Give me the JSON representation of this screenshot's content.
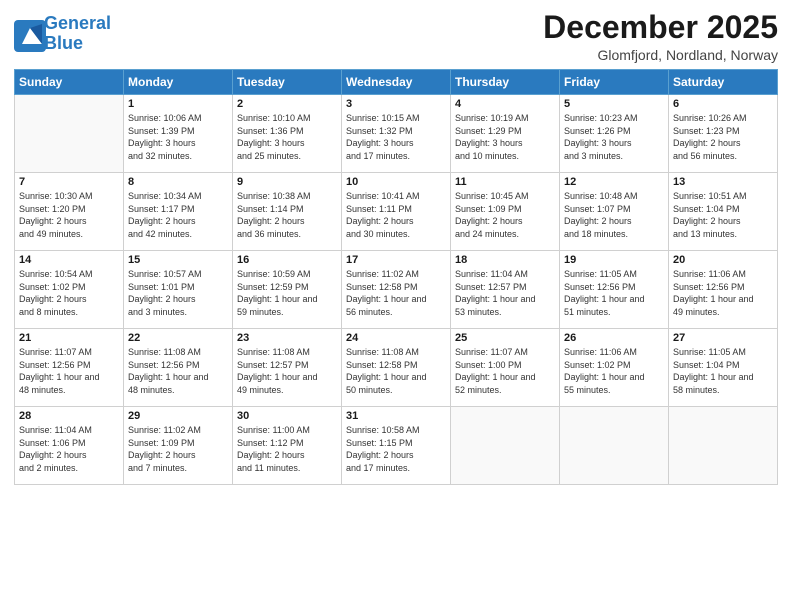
{
  "logo": {
    "line1": "General",
    "line2": "Blue"
  },
  "title": "December 2025",
  "subtitle": "Glomfjord, Nordland, Norway",
  "weekdays": [
    "Sunday",
    "Monday",
    "Tuesday",
    "Wednesday",
    "Thursday",
    "Friday",
    "Saturday"
  ],
  "weeks": [
    [
      {
        "day": "",
        "info": ""
      },
      {
        "day": "1",
        "info": "Sunrise: 10:06 AM\nSunset: 1:39 PM\nDaylight: 3 hours\nand 32 minutes."
      },
      {
        "day": "2",
        "info": "Sunrise: 10:10 AM\nSunset: 1:36 PM\nDaylight: 3 hours\nand 25 minutes."
      },
      {
        "day": "3",
        "info": "Sunrise: 10:15 AM\nSunset: 1:32 PM\nDaylight: 3 hours\nand 17 minutes."
      },
      {
        "day": "4",
        "info": "Sunrise: 10:19 AM\nSunset: 1:29 PM\nDaylight: 3 hours\nand 10 minutes."
      },
      {
        "day": "5",
        "info": "Sunrise: 10:23 AM\nSunset: 1:26 PM\nDaylight: 3 hours\nand 3 minutes."
      },
      {
        "day": "6",
        "info": "Sunrise: 10:26 AM\nSunset: 1:23 PM\nDaylight: 2 hours\nand 56 minutes."
      }
    ],
    [
      {
        "day": "7",
        "info": "Sunrise: 10:30 AM\nSunset: 1:20 PM\nDaylight: 2 hours\nand 49 minutes."
      },
      {
        "day": "8",
        "info": "Sunrise: 10:34 AM\nSunset: 1:17 PM\nDaylight: 2 hours\nand 42 minutes."
      },
      {
        "day": "9",
        "info": "Sunrise: 10:38 AM\nSunset: 1:14 PM\nDaylight: 2 hours\nand 36 minutes."
      },
      {
        "day": "10",
        "info": "Sunrise: 10:41 AM\nSunset: 1:11 PM\nDaylight: 2 hours\nand 30 minutes."
      },
      {
        "day": "11",
        "info": "Sunrise: 10:45 AM\nSunset: 1:09 PM\nDaylight: 2 hours\nand 24 minutes."
      },
      {
        "day": "12",
        "info": "Sunrise: 10:48 AM\nSunset: 1:07 PM\nDaylight: 2 hours\nand 18 minutes."
      },
      {
        "day": "13",
        "info": "Sunrise: 10:51 AM\nSunset: 1:04 PM\nDaylight: 2 hours\nand 13 minutes."
      }
    ],
    [
      {
        "day": "14",
        "info": "Sunrise: 10:54 AM\nSunset: 1:02 PM\nDaylight: 2 hours\nand 8 minutes."
      },
      {
        "day": "15",
        "info": "Sunrise: 10:57 AM\nSunset: 1:01 PM\nDaylight: 2 hours\nand 3 minutes."
      },
      {
        "day": "16",
        "info": "Sunrise: 10:59 AM\nSunset: 12:59 PM\nDaylight: 1 hour and\n59 minutes."
      },
      {
        "day": "17",
        "info": "Sunrise: 11:02 AM\nSunset: 12:58 PM\nDaylight: 1 hour and\n56 minutes."
      },
      {
        "day": "18",
        "info": "Sunrise: 11:04 AM\nSunset: 12:57 PM\nDaylight: 1 hour and\n53 minutes."
      },
      {
        "day": "19",
        "info": "Sunrise: 11:05 AM\nSunset: 12:56 PM\nDaylight: 1 hour and\n51 minutes."
      },
      {
        "day": "20",
        "info": "Sunrise: 11:06 AM\nSunset: 12:56 PM\nDaylight: 1 hour and\n49 minutes."
      }
    ],
    [
      {
        "day": "21",
        "info": "Sunrise: 11:07 AM\nSunset: 12:56 PM\nDaylight: 1 hour and\n48 minutes."
      },
      {
        "day": "22",
        "info": "Sunrise: 11:08 AM\nSunset: 12:56 PM\nDaylight: 1 hour and\n48 minutes."
      },
      {
        "day": "23",
        "info": "Sunrise: 11:08 AM\nSunset: 12:57 PM\nDaylight: 1 hour and\n49 minutes."
      },
      {
        "day": "24",
        "info": "Sunrise: 11:08 AM\nSunset: 12:58 PM\nDaylight: 1 hour and\n50 minutes."
      },
      {
        "day": "25",
        "info": "Sunrise: 11:07 AM\nSunset: 1:00 PM\nDaylight: 1 hour and\n52 minutes."
      },
      {
        "day": "26",
        "info": "Sunrise: 11:06 AM\nSunset: 1:02 PM\nDaylight: 1 hour and\n55 minutes."
      },
      {
        "day": "27",
        "info": "Sunrise: 11:05 AM\nSunset: 1:04 PM\nDaylight: 1 hour and\n58 minutes."
      }
    ],
    [
      {
        "day": "28",
        "info": "Sunrise: 11:04 AM\nSunset: 1:06 PM\nDaylight: 2 hours\nand 2 minutes."
      },
      {
        "day": "29",
        "info": "Sunrise: 11:02 AM\nSunset: 1:09 PM\nDaylight: 2 hours\nand 7 minutes."
      },
      {
        "day": "30",
        "info": "Sunrise: 11:00 AM\nSunset: 1:12 PM\nDaylight: 2 hours\nand 11 minutes."
      },
      {
        "day": "31",
        "info": "Sunrise: 10:58 AM\nSunset: 1:15 PM\nDaylight: 2 hours\nand 17 minutes."
      },
      {
        "day": "",
        "info": ""
      },
      {
        "day": "",
        "info": ""
      },
      {
        "day": "",
        "info": ""
      }
    ]
  ]
}
